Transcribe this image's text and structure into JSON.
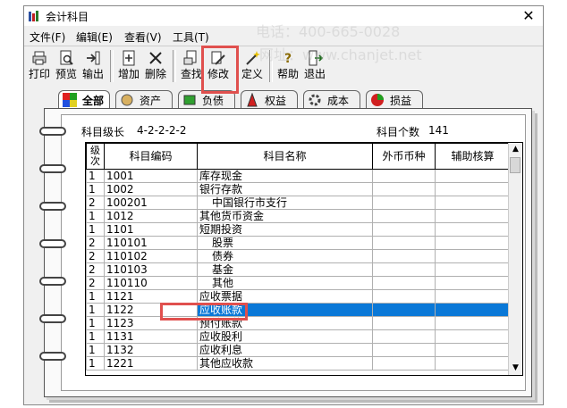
{
  "window": {
    "title": "会计科目",
    "close_glyph": "✕"
  },
  "menu": [
    {
      "label": "文件(F)"
    },
    {
      "label": "编辑(E)"
    },
    {
      "label": "查看(V)"
    },
    {
      "label": "工具(T)"
    }
  ],
  "toolbar": [
    {
      "label": "打印",
      "icon": "printer-icon"
    },
    {
      "label": "预览",
      "icon": "preview-icon"
    },
    {
      "label": "输出",
      "icon": "export-icon"
    },
    {
      "label": "增加",
      "icon": "add-icon"
    },
    {
      "label": "删除",
      "icon": "delete-icon"
    },
    {
      "label": "查找",
      "icon": "find-icon"
    },
    {
      "label": "修改",
      "icon": "edit-icon"
    },
    {
      "label": "定义",
      "icon": "define-icon"
    },
    {
      "label": "帮助",
      "icon": "help-icon"
    },
    {
      "label": "退出",
      "icon": "exit-icon"
    }
  ],
  "tabs": [
    {
      "label": "全部",
      "icon": "all-icon",
      "active": true
    },
    {
      "label": "资产",
      "icon": "asset-icon"
    },
    {
      "label": "负债",
      "icon": "liability-icon"
    },
    {
      "label": "权益",
      "icon": "equity-icon"
    },
    {
      "label": "成本",
      "icon": "cost-icon"
    },
    {
      "label": "损益",
      "icon": "profit-loss-icon"
    }
  ],
  "info": {
    "level_label": "科目级长",
    "level_value": "4-2-2-2-2",
    "count_label": "科目个数",
    "count_value": "141"
  },
  "table": {
    "headers": [
      "级次",
      "科目编码",
      "科目名称",
      "外币币种",
      "辅助核算"
    ],
    "rows": [
      {
        "level": "1",
        "code": "1001",
        "name": "库存现金",
        "currency": "",
        "aux": ""
      },
      {
        "level": "1",
        "code": "1002",
        "name": "银行存款",
        "currency": "",
        "aux": ""
      },
      {
        "level": "2",
        "code": "100201",
        "name": "中国银行市支行",
        "currency": "",
        "aux": ""
      },
      {
        "level": "1",
        "code": "1012",
        "name": "其他货币资金",
        "currency": "",
        "aux": ""
      },
      {
        "level": "1",
        "code": "1101",
        "name": "短期投资",
        "currency": "",
        "aux": ""
      },
      {
        "level": "2",
        "code": "110101",
        "name": "股票",
        "currency": "",
        "aux": ""
      },
      {
        "level": "2",
        "code": "110102",
        "name": "债券",
        "currency": "",
        "aux": ""
      },
      {
        "level": "2",
        "code": "110103",
        "name": "基金",
        "currency": "",
        "aux": ""
      },
      {
        "level": "2",
        "code": "110110",
        "name": "其他",
        "currency": "",
        "aux": ""
      },
      {
        "level": "1",
        "code": "1121",
        "name": "应收票据",
        "currency": "",
        "aux": ""
      },
      {
        "level": "1",
        "code": "1122",
        "name": "应收账款",
        "currency": "",
        "aux": "",
        "selected": true
      },
      {
        "level": "1",
        "code": "1123",
        "name": "预付账款",
        "currency": "",
        "aux": ""
      },
      {
        "level": "1",
        "code": "1131",
        "name": "应收股利",
        "currency": "",
        "aux": ""
      },
      {
        "level": "1",
        "code": "1132",
        "name": "应收利息",
        "currency": "",
        "aux": ""
      },
      {
        "level": "1",
        "code": "1221",
        "name": "其他应收款",
        "currency": "",
        "aux": ""
      }
    ]
  },
  "watermark": {
    "phone": "电话：400-665-0028",
    "site": "网址：www.chanjet.net"
  },
  "colors": {
    "highlight": "#e0504e",
    "selection": "#0a78d7"
  }
}
